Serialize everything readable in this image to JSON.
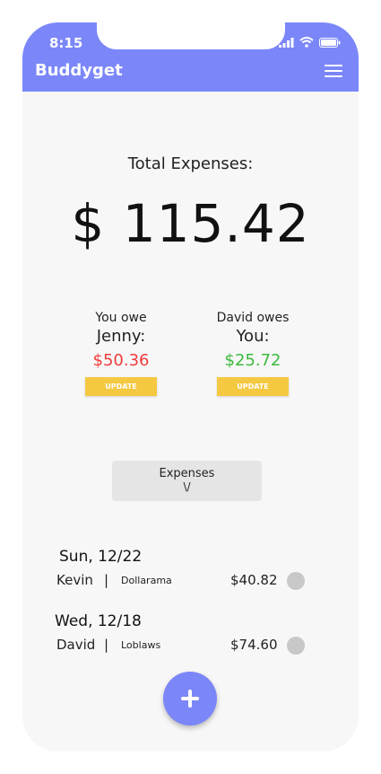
{
  "status": {
    "time": "8:15"
  },
  "header": {
    "title": "Buddyget",
    "menu_icon": "hamburger-menu-icon"
  },
  "total": {
    "label": "Total Expenses:",
    "amount": "$ 115.42"
  },
  "balances": [
    {
      "line1": "You owe",
      "line2": "Jenny:",
      "amount": "$50.36",
      "status": "owed",
      "color": "#ef3b3b",
      "button": "UPDATE"
    },
    {
      "line1": "David owes",
      "line2": "You:",
      "amount": "$25.72",
      "status": "owing",
      "color": "#3db83d",
      "button": "UPDATE"
    }
  ],
  "expenses_toggle": {
    "label": "Expenses",
    "chevron": "\\/"
  },
  "expenses": [
    {
      "date": "Sun, 12/22",
      "person": "Kevin",
      "separator": "|",
      "store": "Dollarama",
      "price": "$40.82"
    },
    {
      "date": "Wed, 12/18",
      "person": "David",
      "separator": "|",
      "store": "Loblaws",
      "price": "$74.60"
    }
  ],
  "fab": {
    "icon": "plus-icon"
  },
  "colors": {
    "accent": "#7b87f8",
    "button": "#f5c842",
    "negative": "#ef3b3b",
    "positive": "#3db83d"
  }
}
